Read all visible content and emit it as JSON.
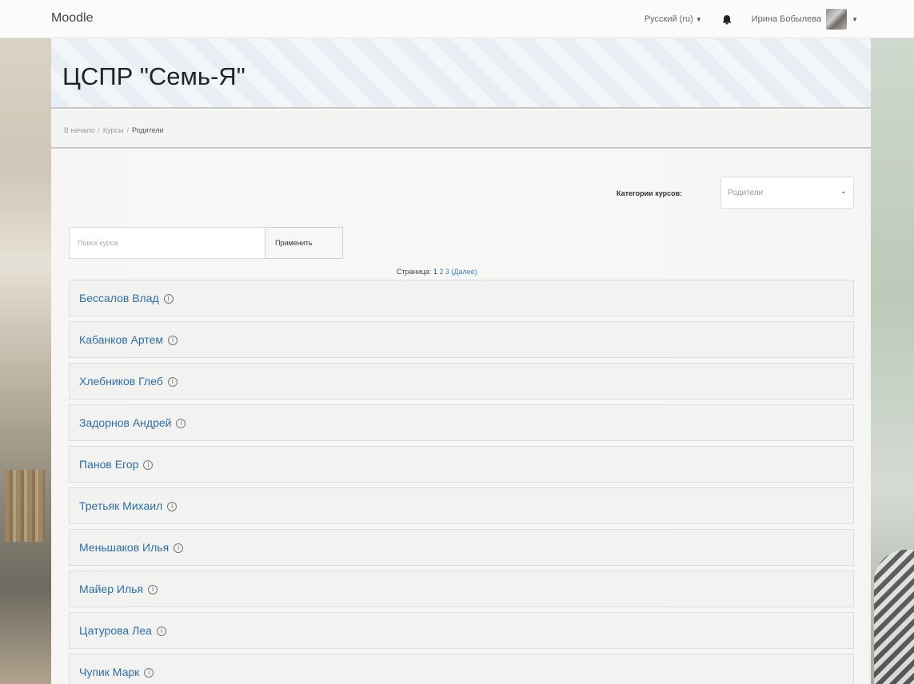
{
  "navbar": {
    "brand": "Moodle",
    "language": "Русский (ru)",
    "user_name": "Ирина Бобылева"
  },
  "header": {
    "title": "ЦСПР \"Семь-Я\""
  },
  "breadcrumb": {
    "items": [
      "В начало",
      "Курсы",
      "Родители"
    ]
  },
  "filters": {
    "category_label": "Категории курсов:",
    "category_value": "Родители",
    "search_placeholder": "Поиск курса",
    "apply_label": "Применить"
  },
  "pager": {
    "label": "Страница:",
    "current": "1",
    "pages": [
      "2",
      "3"
    ],
    "next": "(Далее)"
  },
  "courses": [
    "Бессалов Влад",
    "Кабанков Артем",
    "Хлебников Глеб",
    "Задорнов Андрей",
    "Панов Егор",
    "Третьяк Михаил",
    "Меньшаков Илья",
    "Майер Илья",
    "Цатурова Леа",
    "Чупик Марк"
  ]
}
